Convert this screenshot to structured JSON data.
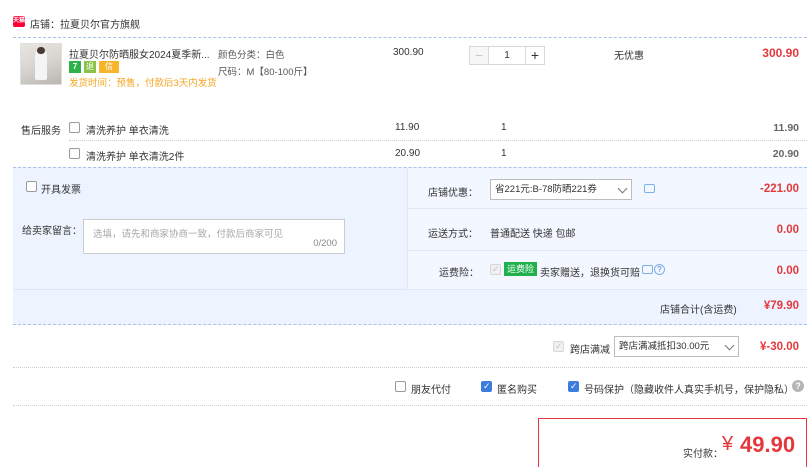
{
  "shop": {
    "label": "店铺：拉夏贝尔官方旗舰",
    "icon": "tmall-shop-icon",
    "icon_text": "天猫"
  },
  "item": {
    "title": "拉夏贝尔防晒服女2024夏季新...",
    "spec_color": "颜色分类：白色",
    "spec_size": "尺码：M【80-100斤】",
    "unit_price": "300.90",
    "quantity": "1",
    "minus": "−",
    "plus": "+",
    "discount": "无优惠",
    "subtotal": "300.90",
    "ship_notice": "发货时间：预售，付款后3天内发货",
    "badges": [
      "7",
      "退",
      "信"
    ]
  },
  "services": {
    "label": "售后服务",
    "rows": [
      {
        "name": "清洗养护 单衣清洗",
        "price": "11.90",
        "qty": "1",
        "total": "11.90"
      },
      {
        "name": "清洗养护 单衣清洗2件",
        "price": "20.90",
        "qty": "1",
        "total": "20.90"
      }
    ]
  },
  "invoice": {
    "label": "开具发票"
  },
  "message": {
    "label": "给卖家留言：",
    "placeholder": "选填，请先和商家协商一致，付款后商家可见",
    "counter": "0/200"
  },
  "coupon": {
    "label": "店铺优惠：",
    "selected": "省221元:B-78防晒221券",
    "amount": "-221.00"
  },
  "shipping": {
    "label": "运送方式：",
    "value": "普通配送 快递 包邮",
    "amount": "0.00"
  },
  "insurance": {
    "label": "运费险：",
    "badge": "运费险",
    "value": "卖家赠送，退换货可赔",
    "amount": "0.00"
  },
  "shop_total": {
    "label": "店铺合计(含运费)",
    "amount": "¥79.90"
  },
  "cross_store": {
    "label": "跨店满减",
    "selected": "跨店满减抵扣30.00元",
    "amount": "¥-30.00"
  },
  "options": {
    "friend_pay": "朋友代付",
    "anonymous": "匿名购买",
    "privacy": "号码保护（隐藏收件人真实手机号，保护隐私）"
  },
  "payment": {
    "label": "实付款：",
    "currency": "¥",
    "amount": "49.90"
  },
  "colors": {
    "accent": "#e4393c",
    "blue": "#3b7ddd",
    "panel": "#eef4ff",
    "notice": "#f5a623"
  }
}
